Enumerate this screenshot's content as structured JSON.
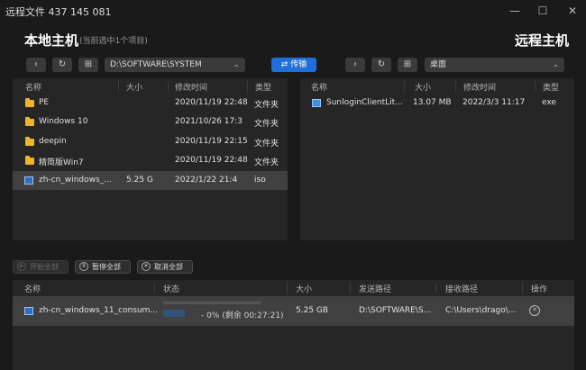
{
  "window": {
    "title": "远程文件 437 145 081",
    "minimize": "—",
    "maximize": "☐",
    "close": "✕"
  },
  "local": {
    "heading": "本地主机",
    "subheading": "(当前选中1个项目)",
    "path": "D:\\SOFTWARE\\SYSTEM",
    "columns": [
      "名称",
      "大小",
      "修改时间",
      "类型"
    ],
    "rows": [
      {
        "name": "PE",
        "size": "",
        "modified": "2020/11/19 22:48",
        "type": "文件夹",
        "icon": "folder-icon"
      },
      {
        "name": "Windows 10",
        "size": "",
        "modified": "2021/10/26 17:3",
        "type": "文件夹",
        "icon": "folder-icon"
      },
      {
        "name": "deepin",
        "size": "",
        "modified": "2020/11/19 22:15",
        "type": "文件夹",
        "icon": "folder-icon"
      },
      {
        "name": "精简版Win7",
        "size": "",
        "modified": "2020/11/19 22:48",
        "type": "文件夹",
        "icon": "folder-icon"
      },
      {
        "name": "zh-cn_windows_...",
        "size": "5.25 G",
        "modified": "2022/1/22 21:4",
        "type": "iso",
        "icon": "iso-file-icon",
        "selected": true
      }
    ]
  },
  "transfer_button": "⇄ 传输",
  "remote": {
    "heading": "远程主机",
    "path": "桌面",
    "columns": [
      "名称",
      "大小",
      "修改时间",
      "类型"
    ],
    "rows": [
      {
        "name": "SunloginClientLit...",
        "size": "13.07 MB",
        "modified": "2022/3/3 11:17",
        "type": "exe",
        "icon": "exe-file-icon"
      }
    ]
  },
  "actions": {
    "start_all": "开始全部",
    "pause_all": "暂停全部",
    "cancel_all": "取消全部"
  },
  "queue": {
    "columns": [
      "名称",
      "状态",
      "大小",
      "发送路径",
      "接收路径",
      "操作"
    ],
    "rows": [
      {
        "name": "zh-cn_windows_11_consum...",
        "status": "- 0% (剩余 00:27:21)",
        "progress": 0.0,
        "size": "5.25 GB",
        "send_path": "D:\\SOFTWARE\\S...",
        "recv_path": "C:\\Users\\drago\\..."
      }
    ]
  },
  "colors": {
    "accent": "#1e6fd9",
    "folder": "#f0b429",
    "background": "#1a1a1a",
    "panel": "#262626"
  }
}
